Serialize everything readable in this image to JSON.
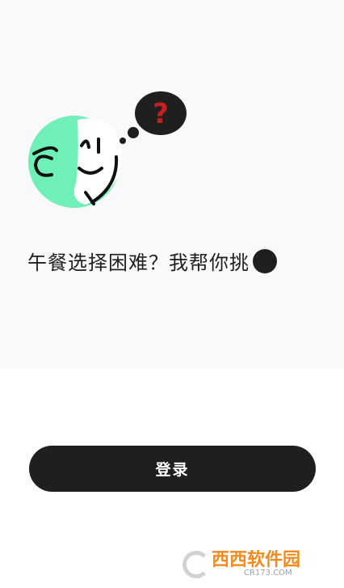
{
  "tagline": {
    "text": "午餐选择困难？我帮你挑"
  },
  "illustration": {
    "icon": "thinking-face-icon",
    "bubble_text": "?"
  },
  "login_button": {
    "label": "登录"
  },
  "watermark": {
    "brand": "西西软件园",
    "domain": "CR173.COM",
    "icon": "cr173-logo-icon"
  },
  "colors": {
    "background": "#ffffff",
    "panel": "#f9f9fb",
    "text": "#1f1f1f",
    "button": "#1f1f1f",
    "face_green": "#6ff0b6",
    "question_red": "#c81e1e"
  }
}
